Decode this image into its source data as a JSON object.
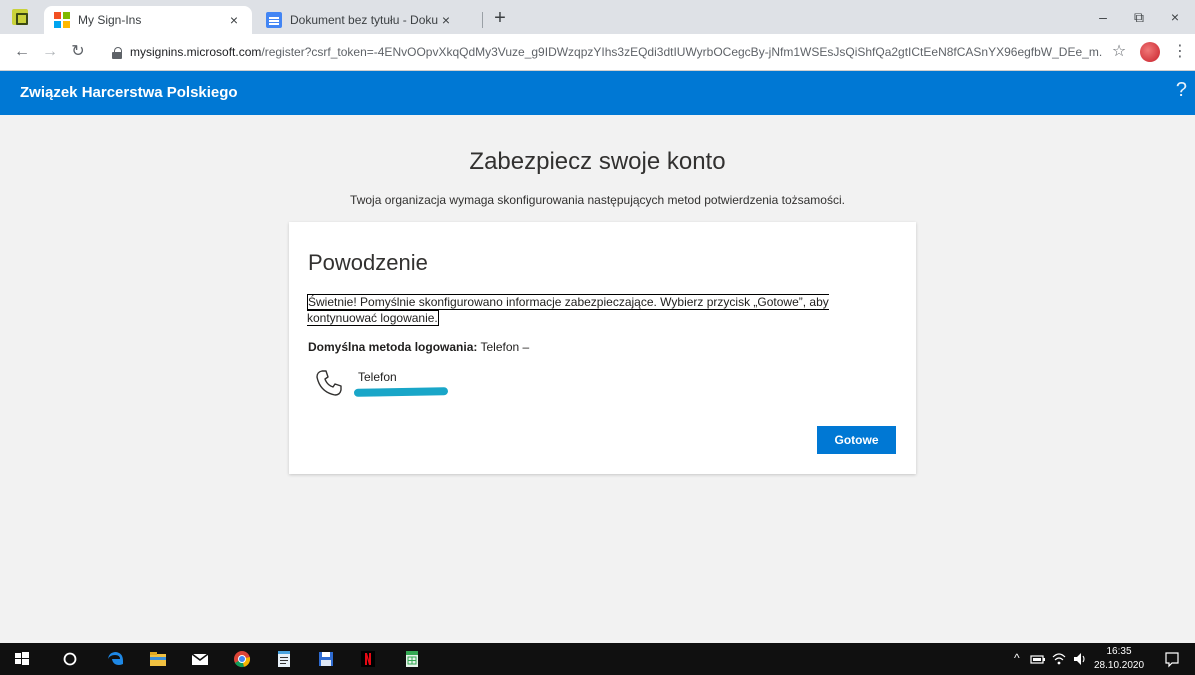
{
  "browser": {
    "tabs": [
      {
        "title": "My Sign-Ins",
        "close": "×"
      },
      {
        "title": "Dokument bez tytułu - Dokumen",
        "close": "×"
      }
    ],
    "new_tab": "+",
    "window_controls": {
      "minimize": "–",
      "maximize": "⧉",
      "close": "×"
    },
    "url_host": "mysignins.microsoft.com",
    "url_rest": "/register?csrf_token=-4ENvOOpvXkqQdMy3Vuze_g9IDWzqpzYIhs3zEQdi3dtIUWyrbOCegcBy-jNfm1WSEsJsQiShfQa2gtICtEeN8fCASnYX96egfbW_DEe_m..."
  },
  "app": {
    "org_name": "Związek Harcerstwa Polskiego",
    "help": "?"
  },
  "page": {
    "title": "Zabezpiecz swoje konto",
    "subtitle": "Twoja organizacja wymaga skonfigurowania następujących metod potwierdzenia tożsamości."
  },
  "card": {
    "title": "Powodzenie",
    "message": "Świetnie! Pomyślnie skonfigurowano informacje zabezpieczające. Wybierz przycisk „Gotowe”, aby kontynuować logowanie.",
    "default_method_label": "Domyślna metoda logowania:",
    "default_method_value": "Telefon –",
    "method_name": "Telefon",
    "done_button": "Gotowe"
  },
  "taskbar": {
    "time": "16:35",
    "date": "28.10.2020",
    "icons": [
      "windows-start-icon",
      "cortana-search-icon",
      "edge-icon",
      "file-explorer-icon",
      "mail-icon",
      "chrome-icon",
      "notepad-icon",
      "save-disk-icon",
      "netflix-icon",
      "spreadsheet-icon"
    ]
  },
  "colors": {
    "accent": "#0078d4",
    "redaction": "#19a6c8"
  }
}
